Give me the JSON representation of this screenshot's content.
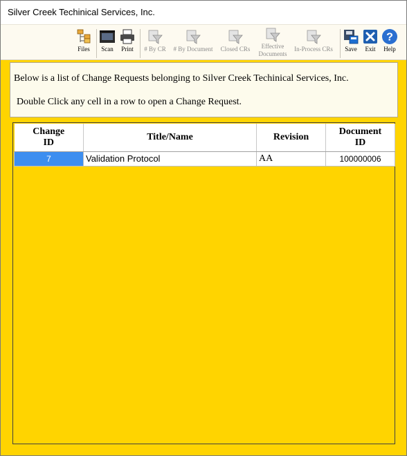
{
  "window": {
    "title": "Silver Creek Techinical Services, Inc."
  },
  "toolbar": {
    "files": {
      "label": "Files",
      "icon": "files-icon"
    },
    "scan": {
      "label": "Scan",
      "icon": "scan-icon"
    },
    "print": {
      "label": "Print",
      "icon": "print-icon"
    },
    "by_cr": {
      "label": "# By CR",
      "icon": "filter-icon"
    },
    "by_document": {
      "label": "# By Document",
      "icon": "filter-icon"
    },
    "closed_crs": {
      "label": "Closed CRs",
      "icon": "filter-icon"
    },
    "effective_documents": {
      "label": "Effective Documents",
      "icon": "filter-icon"
    },
    "in_process_crs": {
      "label": "In-Process CRs",
      "icon": "filter-icon"
    },
    "save": {
      "label": "Save",
      "icon": "save-icon"
    },
    "exit": {
      "label": "Exit",
      "icon": "close-icon"
    },
    "help": {
      "label": "Help",
      "icon": "help-icon"
    }
  },
  "info": {
    "line1": "Below is a list of Change Requests belonging to Silver Creek Techinical Services, Inc.",
    "line2": "Double Click any cell in a row to open a Change Request."
  },
  "table": {
    "columns": {
      "change_id_1": "Change",
      "change_id_2": "ID",
      "title": "Title/Name",
      "revision": "Revision",
      "document_id_1": "Document",
      "document_id_2": "ID"
    },
    "rows": [
      {
        "change_id": "7",
        "title": "Validation Protocol",
        "revision": "AA",
        "document_id": "100000006"
      }
    ]
  },
  "colors": {
    "background": "#ffd400",
    "selection": "#3d8ef0",
    "exit_button": "#1f5fb0",
    "help_button": "#2a6fd0"
  }
}
